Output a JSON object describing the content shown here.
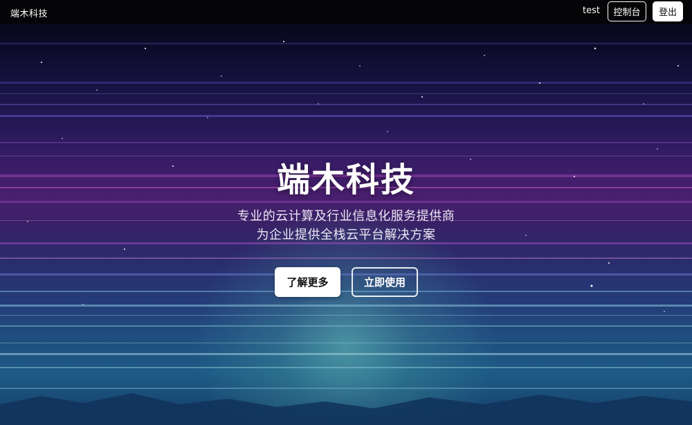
{
  "navbar": {
    "brand": "端木科技",
    "user_name": "test",
    "console_label": "控制台",
    "logout_label": "登出"
  },
  "hero": {
    "title": "端木科技",
    "subtitle_line1": "专业的云计算及行业信息化服务提供商",
    "subtitle_line2": "为企业提供全栈云平台解决方案",
    "learn_more_label": "了解更多",
    "use_now_label": "立即使用"
  },
  "theme": {
    "navbar_bg": "#050507",
    "accent_purple": "#4a1f70",
    "accent_teal": "#6ec8be"
  }
}
